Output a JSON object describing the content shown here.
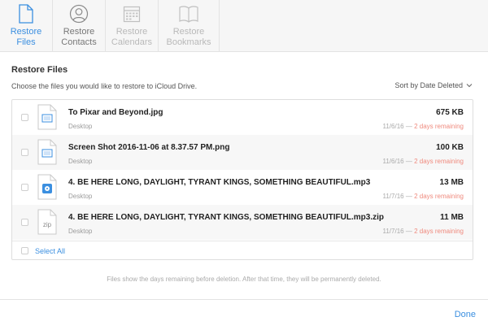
{
  "tabs": [
    {
      "label": "Restore\nFiles",
      "icon": "document-icon",
      "state": "active"
    },
    {
      "label": "Restore\nContacts",
      "icon": "person-circle-icon",
      "state": "normal"
    },
    {
      "label": "Restore\nCalendars",
      "icon": "calendar-icon",
      "state": "disabled"
    },
    {
      "label": "Restore\nBookmarks",
      "icon": "book-icon",
      "state": "disabled"
    }
  ],
  "header": {
    "title": "Restore Files",
    "subtitle": "Choose the files you would like to restore to iCloud Drive.",
    "sort_label": "Sort by Date Deleted"
  },
  "files": [
    {
      "name": "To Pixar and Beyond.jpg",
      "location": "Desktop",
      "size": "675 KB",
      "date": "11/6/16",
      "remaining": "2 days remaining",
      "thumb": "image-file-icon"
    },
    {
      "name": "Screen Shot 2016-11-06 at 8.37.57 PM.png",
      "location": "Desktop",
      "size": "100 KB",
      "date": "11/6/16",
      "remaining": "2 days remaining",
      "thumb": "image-file-icon"
    },
    {
      "name": "4. BE HERE LONG, DAYLIGHT, TYRANT KINGS, SOMETHING BEAUTIFUL.mp3",
      "location": "Desktop",
      "size": "13 MB",
      "date": "11/7/16",
      "remaining": "2 days remaining",
      "thumb": "audio-file-icon"
    },
    {
      "name": "4. BE HERE LONG, DAYLIGHT, TYRANT KINGS, SOMETHING BEAUTIFUL.mp3.zip",
      "location": "Desktop",
      "size": "11 MB",
      "date": "11/7/16",
      "remaining": "2 days remaining",
      "thumb": "zip-file-icon",
      "thumb_text": "zip"
    }
  ],
  "date_separator": "—",
  "select_all_label": "Select All",
  "footer_note": "Files show the days remaining before deletion. After that time, they will be permanently deleted.",
  "done_label": "Done",
  "colors": {
    "accent": "#3b8fe0",
    "warning": "#ef8a7e"
  }
}
